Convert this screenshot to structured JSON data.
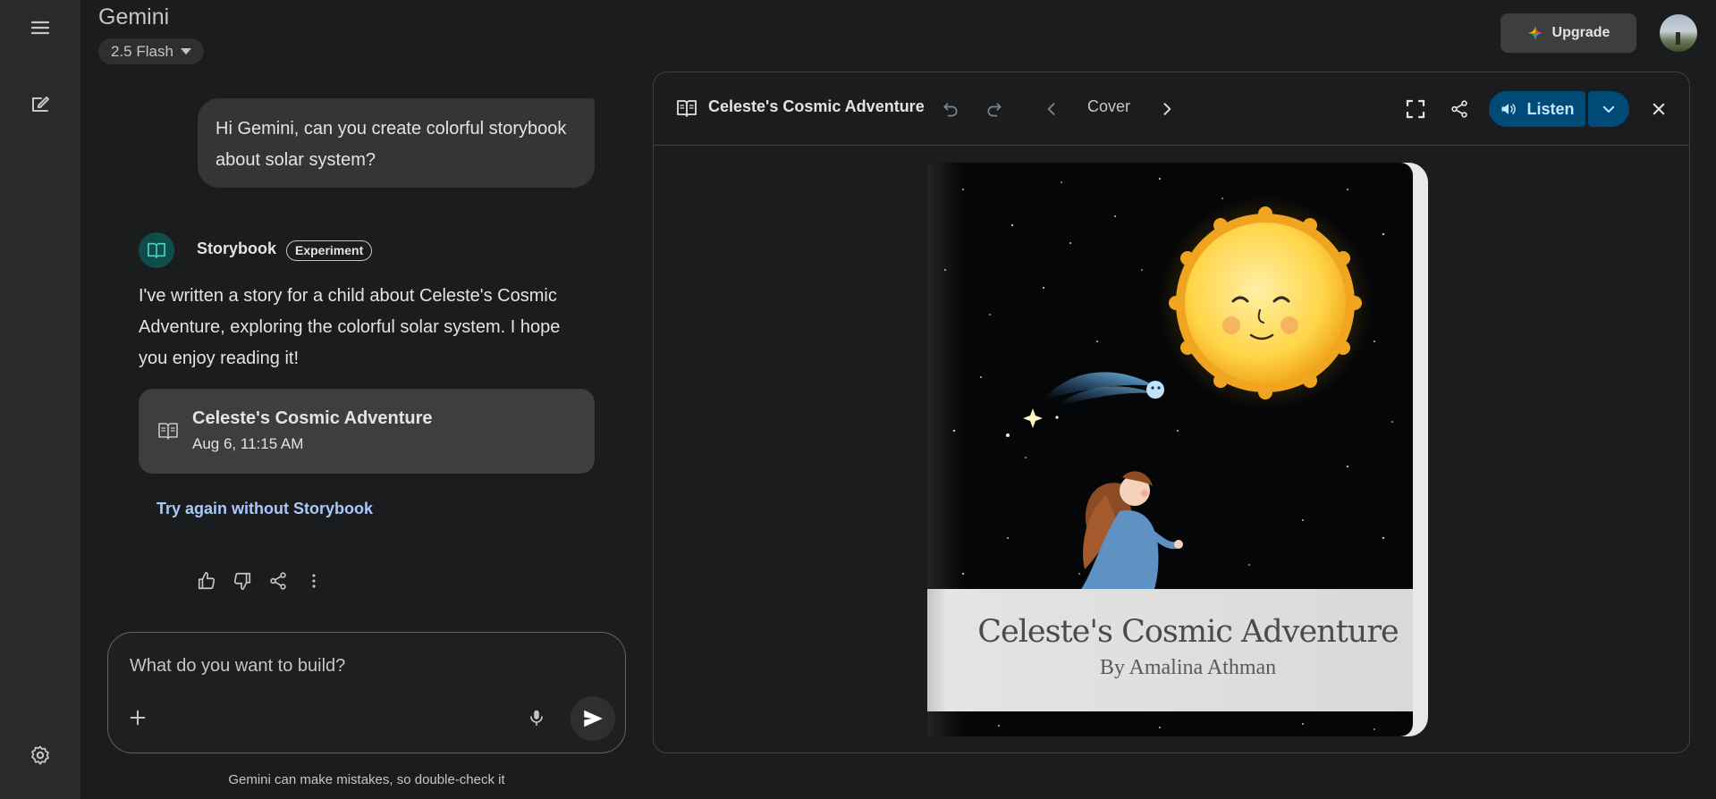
{
  "app": {
    "title": "Gemini",
    "model": "2.5 Flash",
    "upgrade_label": "Upgrade"
  },
  "chat": {
    "user_message": "Hi Gemini, can you create colorful storybook about solar system?",
    "responder": {
      "name": "Storybook",
      "badge": "Experiment"
    },
    "response_text": "I've written a story for a child about Celeste's Cosmic Adventure, exploring the colorful solar system. I hope you enjoy reading it!",
    "story_card": {
      "title": "Celeste's Cosmic Adventure",
      "date": "Aug 6, 11:15 AM"
    },
    "retry_label": "Try again without Storybook"
  },
  "composer": {
    "placeholder": "What do you want to build?"
  },
  "disclaimer": "Gemini can make mistakes, so double-check it",
  "panel": {
    "title": "Celeste's Cosmic Adventure",
    "page_label": "Cover",
    "listen_label": "Listen"
  },
  "book": {
    "title": "Celeste's Cosmic Adventure",
    "author": "By Amalina Athman"
  },
  "colors": {
    "accent": "#004a77",
    "link": "#a8c7fa",
    "background": "#1b1c1d",
    "rail": "#282a2c"
  }
}
